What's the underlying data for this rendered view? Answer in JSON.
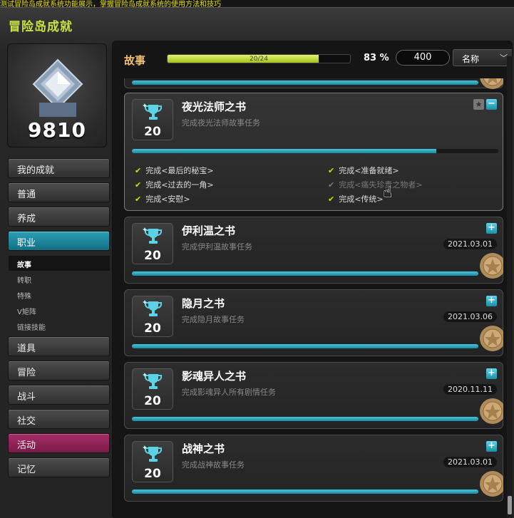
{
  "top_strip": "测试冒险岛成就系统功能展示，掌握冒险岛成就系统的使用方法和技巧",
  "window": {
    "title": "冒险岛成就"
  },
  "profile": {
    "score": "9810"
  },
  "nav": {
    "items": [
      {
        "label": "我的成就"
      },
      {
        "label": "普通"
      },
      {
        "label": "养成"
      },
      {
        "label": "职业",
        "active": true
      },
      {
        "label": "道具"
      },
      {
        "label": "冒险"
      },
      {
        "label": "战斗"
      },
      {
        "label": "社交"
      },
      {
        "label": "活动"
      },
      {
        "label": "记忆"
      }
    ],
    "sub_items": [
      {
        "label": "故事",
        "active": true
      },
      {
        "label": "转职"
      },
      {
        "label": "特殊"
      },
      {
        "label": "V矩阵"
      },
      {
        "label": "链接技能"
      }
    ]
  },
  "header": {
    "category": "故事",
    "progress_text": "20/24",
    "progress_fraction": 0.83,
    "percent": "83 %",
    "points": "400",
    "sort_label": "名称"
  },
  "cards": [
    {
      "title": "夜光法师之书",
      "desc": "完成夜光法师故事任务",
      "points": "20",
      "progress_fraction": 0.83,
      "expanded": true,
      "tasks": [
        {
          "label": "完成<最后的秘宝>",
          "done": true
        },
        {
          "label": "完成<准备就绪>",
          "done": true
        },
        {
          "label": "完成<过去的一角>",
          "done": true
        },
        {
          "label": "完成<痛失珍贵之物者>",
          "done": false
        },
        {
          "label": "完成<安慰>",
          "done": true
        },
        {
          "label": "完成<传统>",
          "done": true
        }
      ]
    },
    {
      "title": "伊利温之书",
      "desc": "完成伊利温故事任务",
      "points": "20",
      "date": "2021.03.01",
      "progress_fraction": 1.0
    },
    {
      "title": "隐月之书",
      "desc": "完成隐月故事任务",
      "points": "20",
      "date": "2021.03.06",
      "progress_fraction": 1.0
    },
    {
      "title": "影魂异人之书",
      "desc": "完成影魂异人所有剧情任务",
      "points": "20",
      "date": "2020.11.11",
      "progress_fraction": 1.0
    },
    {
      "title": "战神之书",
      "desc": "完成战神故事任务",
      "points": "20",
      "date": "2021.03.01",
      "progress_fraction": 1.0
    }
  ],
  "icons": {
    "emblem": "diamond-emblem-icon",
    "trophy": "trophy-icon",
    "seal": "wax-seal-icon",
    "expand": "plus-icon",
    "collapse": "minus-icon",
    "favorite": "star-icon",
    "sort_chevron": "chevron-down-icon",
    "cursor": "hand-cursor-icon"
  },
  "colors": {
    "title": "#c8e040",
    "accent": "#2aa0b6",
    "event": "#a62d66",
    "progress": "#a2c21c",
    "category": "#f0c070",
    "check": "#c8e000"
  }
}
